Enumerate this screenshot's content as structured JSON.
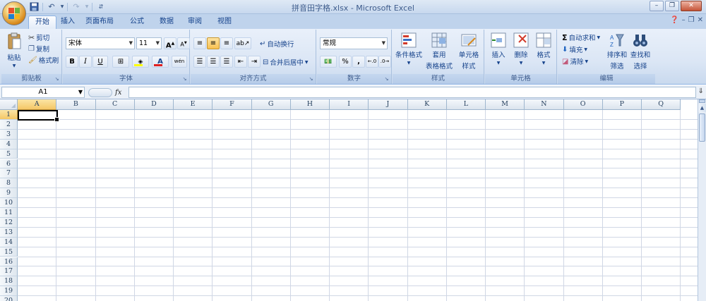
{
  "window": {
    "title": "拼音田字格.xlsx - Microsoft Excel",
    "minimize_label": "–",
    "restore_label": "❐",
    "close_label": "✕"
  },
  "qat": {
    "save_icon": "save-icon",
    "undo_icon": "undo-icon",
    "redo_icon": "redo-icon",
    "customize_icon": "customize-icon"
  },
  "tabs": [
    {
      "label": "开始",
      "active": true
    },
    {
      "label": "插入",
      "active": false
    },
    {
      "label": "页面布局",
      "active": false
    },
    {
      "label": "公式",
      "active": false
    },
    {
      "label": "数据",
      "active": false
    },
    {
      "label": "审阅",
      "active": false
    },
    {
      "label": "视图",
      "active": false
    }
  ],
  "ribbon": {
    "clipboard": {
      "name": "剪贴板",
      "paste": "粘贴",
      "cut": "剪切",
      "copy": "复制",
      "format_painter": "格式刷"
    },
    "font": {
      "name": "字体",
      "font_family": "宋体",
      "font_size": "11",
      "bold": "B",
      "italic": "I",
      "underline": "U",
      "grow": "A",
      "shrink": "A",
      "font_color_letter": "A",
      "font_color": "#e02020",
      "fill_color": "#ffff00",
      "phonetic": "wén"
    },
    "alignment": {
      "name": "对齐方式",
      "wrap_text": "自动换行",
      "merge_center": "合并后居中"
    },
    "number": {
      "name": "数字",
      "format": "常规",
      "percent": "%",
      "comma": ",",
      "inc_decimal": ".00",
      "dec_decimal": ".00"
    },
    "styles": {
      "name": "样式",
      "conditional": "条件格式",
      "table_format_1": "套用",
      "table_format_2": "表格格式",
      "cell_styles_1": "单元格",
      "cell_styles_2": "样式"
    },
    "cells": {
      "name": "单元格",
      "insert": "插入",
      "delete": "删除",
      "format": "格式"
    },
    "editing": {
      "name": "编辑",
      "autosum": "自动求和",
      "fill": "填充",
      "clear": "清除",
      "sort_1": "排序和",
      "sort_2": "筛选",
      "find_1": "查找和",
      "find_2": "选择"
    }
  },
  "formula_bar": {
    "name_box": "A1",
    "fx": "fx",
    "formula": ""
  },
  "sheet": {
    "columns": [
      "A",
      "B",
      "C",
      "D",
      "E",
      "F",
      "G",
      "H",
      "I",
      "J",
      "K",
      "L",
      "M",
      "N",
      "O",
      "P",
      "Q"
    ],
    "rows": [
      "1",
      "2",
      "3",
      "4",
      "5",
      "6",
      "7",
      "8",
      "9",
      "10",
      "11",
      "12",
      "13",
      "14",
      "15",
      "16",
      "17",
      "18",
      "19",
      "20"
    ],
    "active_cell": "A1"
  }
}
